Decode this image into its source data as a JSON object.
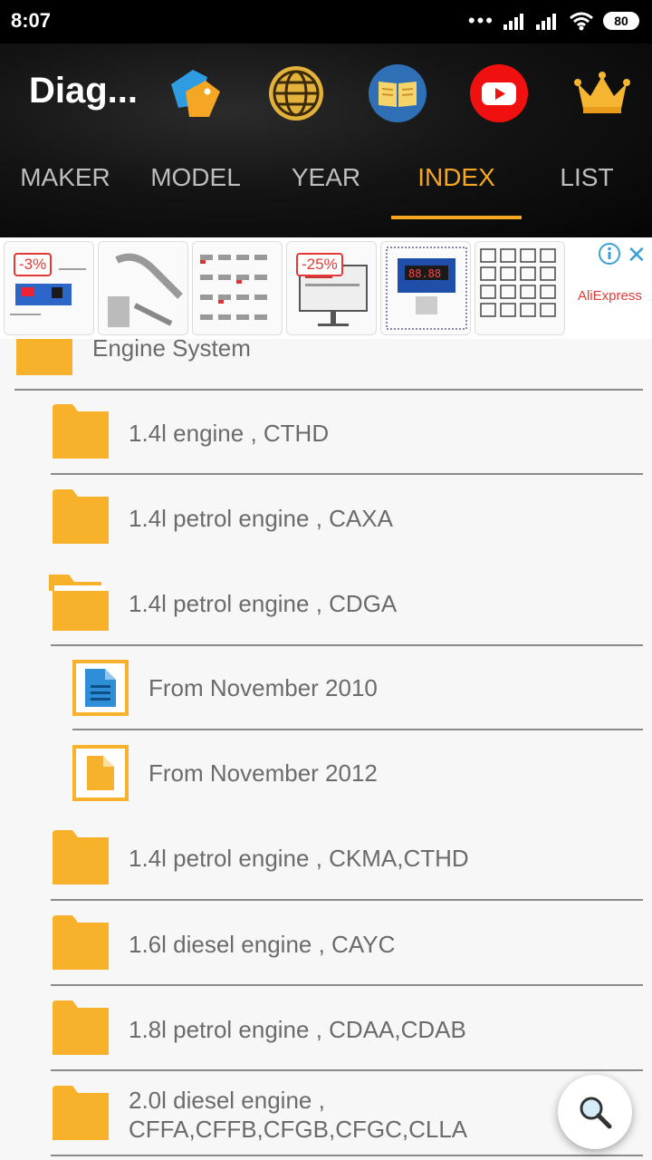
{
  "status": {
    "time": "8:07",
    "battery": "80"
  },
  "header": {
    "title": "Diag..."
  },
  "icons": [
    "tag-icon",
    "globe-icon",
    "book-icon",
    "youtube-icon",
    "crown-icon"
  ],
  "tabs": [
    {
      "label": "MAKER"
    },
    {
      "label": "MODEL"
    },
    {
      "label": "YEAR"
    },
    {
      "label": "INDEX",
      "active": true
    },
    {
      "label": "LIST"
    }
  ],
  "ad": {
    "badges": [
      "-3%",
      "-25%"
    ],
    "brand": "AliExpress"
  },
  "list": {
    "section": "Engine System",
    "items": [
      {
        "label": "1.4l engine , CTHD"
      },
      {
        "label": "1.4l petrol engine , CAXA"
      },
      {
        "label": "1.4l petrol engine , CDGA"
      },
      {
        "label": "From November 2010"
      },
      {
        "label": "From November 2012"
      },
      {
        "label": "1.4l petrol engine , CKMA,CTHD"
      },
      {
        "label": "1.6l diesel engine , CAYC"
      },
      {
        "label": "1.8l petrol engine , CDAA,CDAB"
      },
      {
        "label": "2.0l diesel engine ,",
        "label2": "CFFA,CFFB,CFGB,CFGC,CLLA"
      }
    ]
  },
  "colors": {
    "accent": "#f5a623",
    "folder": "#f7b12a",
    "doc_blue": "#2f8ed8"
  }
}
